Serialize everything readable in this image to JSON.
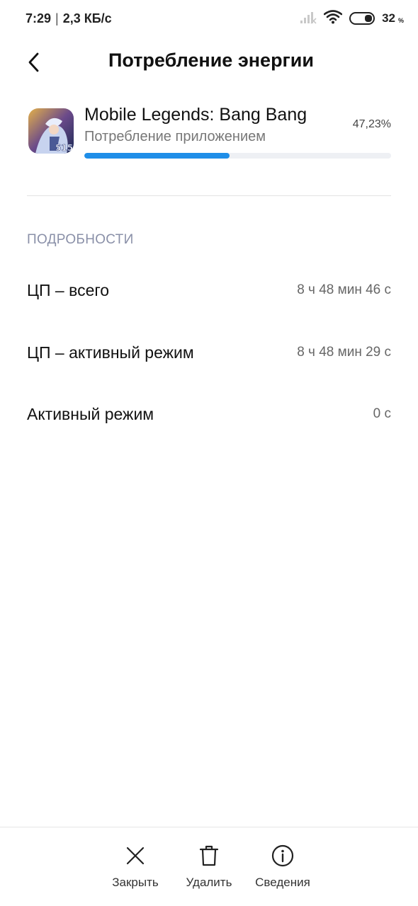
{
  "status_bar": {
    "time": "7:29",
    "separator": "|",
    "speed": "2,3 КБ/с",
    "battery_level": "32",
    "battery_unit": "%"
  },
  "header": {
    "title": "Потребление энергии",
    "back_icon": "chevron-left-icon"
  },
  "app": {
    "name": "Mobile Legends: Bang Bang",
    "subtitle": "Потребление приложением",
    "percent": "47,23%",
    "usage_fraction": 0.4723,
    "progress_color": "#1f8ee8"
  },
  "details": {
    "title": "ПОДРОБНОСТИ",
    "rows": [
      {
        "label": "ЦП – всего",
        "value": "8 ч 48 мин 46 с"
      },
      {
        "label": "ЦП – активный режим",
        "value": "8 ч 48 мин 29 с"
      },
      {
        "label": "Активный режим",
        "value": "0 с"
      }
    ]
  },
  "toolbar": {
    "close_label": "Закрыть",
    "delete_label": "Удалить",
    "info_label": "Сведения"
  }
}
